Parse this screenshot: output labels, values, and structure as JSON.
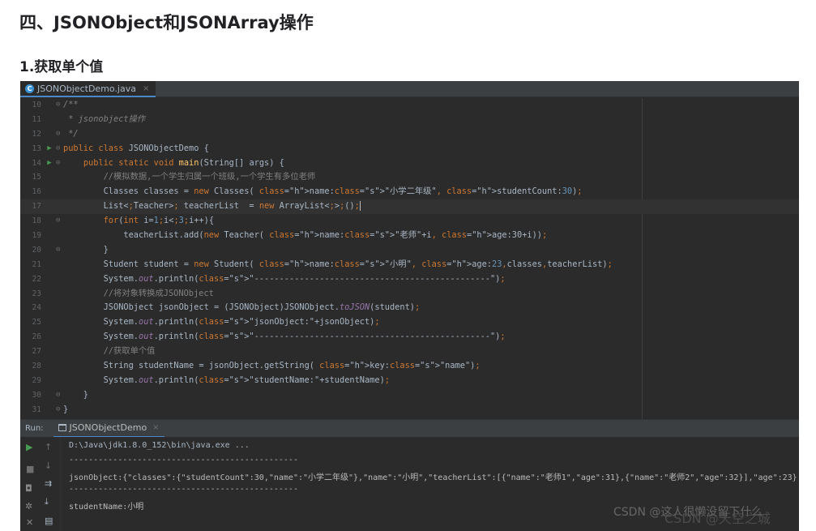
{
  "article": {
    "heading": "四、JSONObject和JSONArray操作",
    "subheading": "1.获取单个值"
  },
  "editor_tab": {
    "filename": "JSONObjectDemo.java",
    "close": "×",
    "icon": "java-class-icon"
  },
  "code_lines": [
    {
      "num": "10",
      "fold": "⊖",
      "text": "/**"
    },
    {
      "num": "11",
      "text": " * jsonobject操作"
    },
    {
      "num": "12",
      "fold": "⊖",
      "text": " */"
    },
    {
      "num": "13",
      "run": "▶",
      "fold": "⊖",
      "text": "public class JSONObjectDemo {"
    },
    {
      "num": "14",
      "run": "▶",
      "fold": "⊖",
      "text": "    public static void main(String[] args) {"
    },
    {
      "num": "15",
      "text": "        //模拟数据,一个学生归属一个班级,一个学生有多位老师"
    },
    {
      "num": "16",
      "text": "        Classes classes = new Classes( name: \"小学二年级\", studentCount: 30);"
    },
    {
      "num": "17",
      "text": "        List<Teacher> teacherList  = new ArrayList<>();",
      "current": true
    },
    {
      "num": "18",
      "fold": "⊖",
      "text": "        for(int i=1;i<3;i++){"
    },
    {
      "num": "19",
      "text": "            teacherList.add(new Teacher( name: \"老师\"+i, age: 30+i));"
    },
    {
      "num": "20",
      "fold": "⊖",
      "text": "        }"
    },
    {
      "num": "21",
      "text": "        Student student = new Student( name: \"小明\", age: 23,classes,teacherList);"
    },
    {
      "num": "22",
      "text": "        System.out.println(\"-----------------------------------------------\");"
    },
    {
      "num": "23",
      "text": "        //将对象转换成JSONObject"
    },
    {
      "num": "24",
      "text": "        JSONObject jsonObject = (JSONObject)JSONObject.toJSON(student);"
    },
    {
      "num": "25",
      "text": "        System.out.println(\"jsonObject:\"+jsonObject);"
    },
    {
      "num": "26",
      "text": "        System.out.println(\"-----------------------------------------------\");"
    },
    {
      "num": "27",
      "text": "        //获取单个值"
    },
    {
      "num": "28",
      "text": "        String studentName = jsonObject.getString( key: \"name\");"
    },
    {
      "num": "29",
      "text": "        System.out.println(\"studentName:\"+studentName);"
    },
    {
      "num": "30",
      "fold": "⊖",
      "text": "    }"
    },
    {
      "num": "31",
      "fold": "⊖",
      "text": "}"
    }
  ],
  "run_panel": {
    "label": "Run:",
    "tab": "JSONObjectDemo",
    "close": "×",
    "output": [
      "D:\\Java\\jdk1.8.0_152\\bin\\java.exe ...",
      "-----------------------------------------------",
      "jsonObject:{\"classes\":{\"studentCount\":30,\"name\":\"小学二年级\"},\"name\":\"小明\",\"teacherList\":[{\"name\":\"老师1\",\"age\":31},{\"name\":\"老师2\",\"age\":32}],\"age\":23}",
      "-----------------------------------------------",
      "studentName:小明"
    ],
    "tools": [
      "run-icon",
      "up-arrow-icon",
      "stop-icon",
      "down-arrow-icon",
      "camera-icon",
      "wrap-icon",
      "settings-icon",
      "scroll-end-icon",
      "close-icon",
      "print-icon"
    ]
  },
  "watermark": {
    "text": "CSDN @这人很懒没留下什么",
    "overlay": "CSDN @天空之城"
  }
}
